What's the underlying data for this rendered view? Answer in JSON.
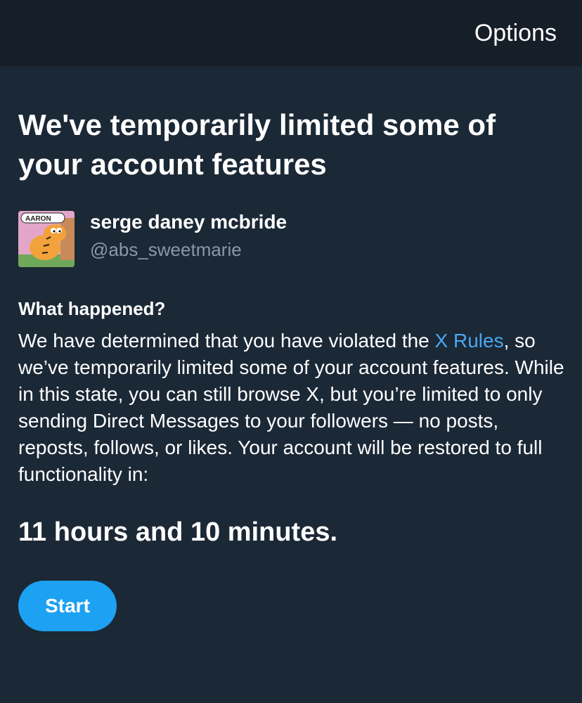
{
  "header": {
    "options_label": "Options"
  },
  "title": "We've temporarily limited some of your account features",
  "user": {
    "display_name": "serge daney mcbride",
    "handle": "@abs_sweetmarie",
    "avatar_caption": "AARON"
  },
  "section": {
    "heading": "What happened?",
    "text_before_link": "We have determined that you have violated the ",
    "link_text": "X Rules",
    "text_after_link": ", so we’ve temporarily limited some of your account features. While in this state, you can still browse X, but you’re limited to only sending Direct Messages to your followers — no posts, reposts, follows, or likes. Your account will be restored to full functionality in:"
  },
  "countdown": "11 hours and 10 minutes.",
  "start_label": "Start",
  "colors": {
    "background": "#1b2836",
    "header_bg": "#161e27",
    "link": "#4aa8f0",
    "button": "#1da1f2",
    "secondary_text": "#8899a6"
  }
}
